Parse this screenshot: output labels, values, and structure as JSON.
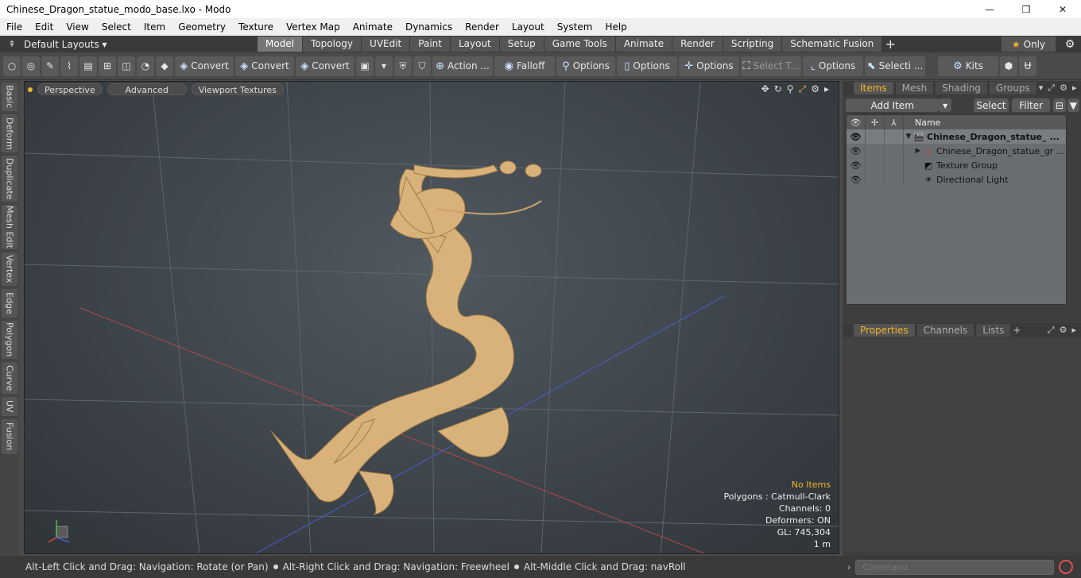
{
  "window": {
    "title": "Chinese_Dragon_statue_modo_base.lxo - Modo",
    "minimize": "—",
    "maximize": "❐",
    "close": "✕"
  },
  "menu": [
    "File",
    "Edit",
    "View",
    "Select",
    "Item",
    "Geometry",
    "Texture",
    "Vertex Map",
    "Animate",
    "Dynamics",
    "Render",
    "Layout",
    "System",
    "Help"
  ],
  "layoutbar": {
    "layouts_label": "Default Layouts ▾",
    "tabs": [
      "Model",
      "Topology",
      "UVEdit",
      "Paint",
      "Layout",
      "Setup",
      "Game Tools",
      "Animate",
      "Render",
      "Scripting",
      "Schematic Fusion"
    ],
    "active_tab": "Model",
    "add_tab": "+",
    "only_label": "Only"
  },
  "toolbar": {
    "convert1": "Convert",
    "convert2": "Convert",
    "convert3": "Convert",
    "action": "Action ...",
    "falloff": "Falloff",
    "options1": "Options",
    "options2": "Options",
    "options3": "Options",
    "select_t": "Select T...",
    "options4": "Options",
    "selecti": "Selecti ...",
    "kits": "Kits"
  },
  "left_tabs": [
    "Basic",
    "Deform",
    "Duplicate",
    "Mesh Edit",
    "Vertex",
    "Edge",
    "Polygon",
    "Curve",
    "UV",
    "Fusion"
  ],
  "viewport": {
    "perspective": "Perspective",
    "advanced": "Advanced",
    "textures": "Viewport Textures",
    "info": {
      "no_items": "No Items",
      "polygons": "Polygons : Catmull-Clark",
      "channels": "Channels: 0",
      "deformers": "Deformers: ON",
      "gl": "GL: 745,304",
      "scale": "1 m"
    },
    "model_color": "#d8b27a"
  },
  "status": {
    "part1": "Alt-Left Click and Drag: Navigation: Rotate (or Pan)",
    "part2": "Alt-Right Click and Drag: Navigation: Freewheel",
    "part3": "Alt-Middle Click and Drag: navRoll"
  },
  "items_panel": {
    "tabs": [
      "Items",
      "Mesh ...",
      "Shading",
      "Groups"
    ],
    "active_tab": "Items",
    "add_item": "Add Item",
    "select": "Select",
    "filter": "Filter",
    "name_header": "Name",
    "rows": [
      {
        "name": "Chinese_Dragon_statue_ ...",
        "icon": "scene-icon"
      },
      {
        "name": "Chinese_Dragon_statue_gr ...",
        "icon": "mesh-icon"
      },
      {
        "name": "Texture Group",
        "icon": "texture-group-icon"
      },
      {
        "name": "Directional Light",
        "icon": "light-icon"
      }
    ]
  },
  "properties_panel": {
    "tabs": [
      "Properties",
      "Channels",
      "Lists"
    ],
    "active_tab": "Properties",
    "add_tab": "+"
  },
  "command": {
    "placeholder": "Command"
  },
  "colors": {
    "accent": "#f0b429",
    "record": "#e05050"
  }
}
